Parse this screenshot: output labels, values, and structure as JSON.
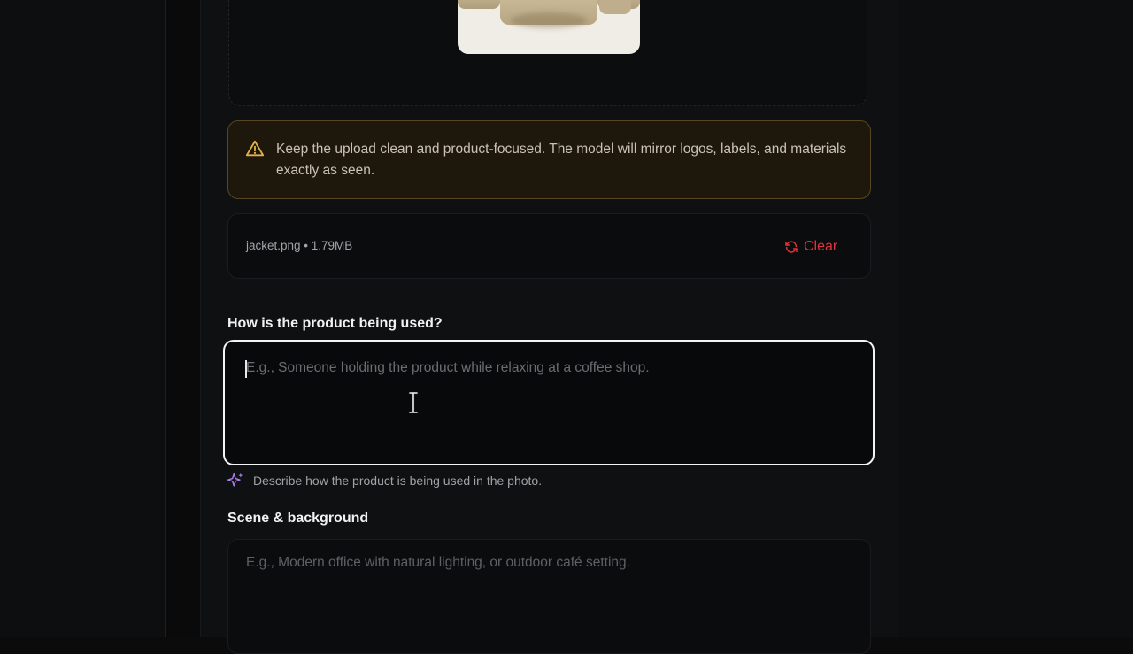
{
  "upload": {
    "image_subject": "beige jacket product photo"
  },
  "warning": {
    "text": "Keep the upload clean and product-focused. The model will mirror logos, labels, and materials exactly as seen.",
    "color": "#e0b24a"
  },
  "file": {
    "name_size": "jacket.png • 1.79MB",
    "clear_label": "Clear",
    "clear_color": "#e0343c"
  },
  "usage": {
    "label": "How is the product being used?",
    "placeholder": "E.g., Someone holding the product while relaxing at a coffee shop.",
    "hint": "Describe how the product is being used in the photo."
  },
  "scene": {
    "label": "Scene & background",
    "placeholder": "E.g., Modern office with natural lighting, or outdoor café setting."
  },
  "icons": {
    "warning": "warning-triangle-icon",
    "clear": "refresh-icon",
    "hint": "sparkle-icon",
    "cursor": "text-cursor-icon"
  }
}
